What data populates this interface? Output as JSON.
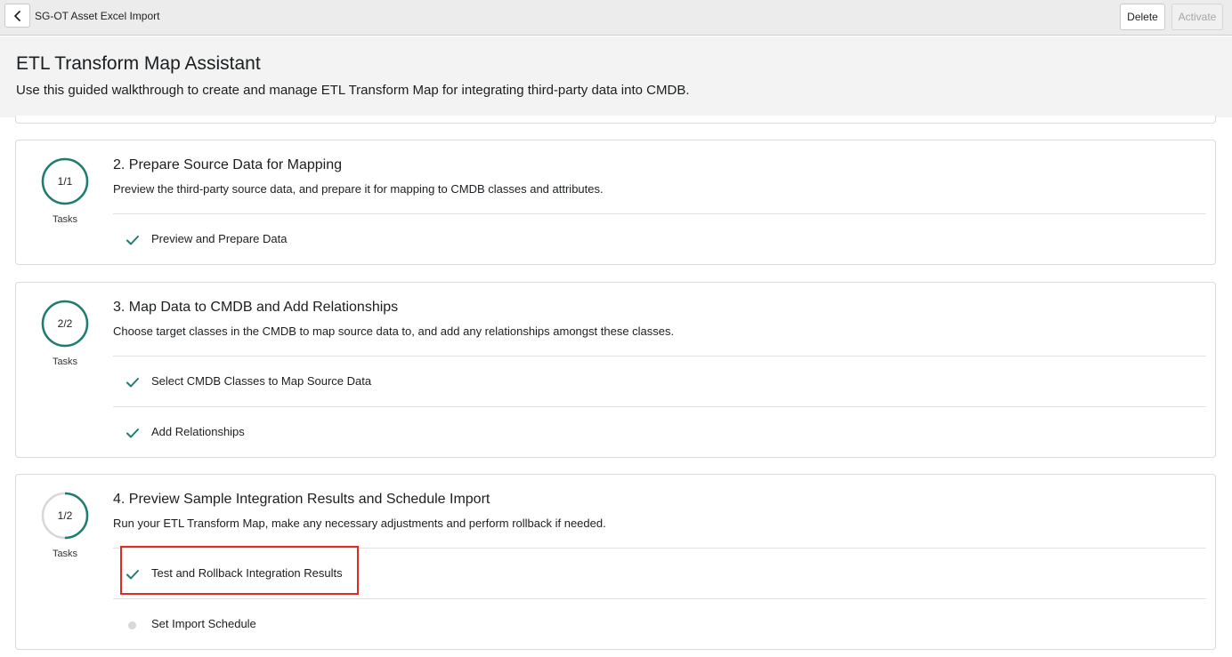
{
  "topbar": {
    "title": "SG-OT Asset Excel Import",
    "delete_label": "Delete",
    "activate_label": "Activate"
  },
  "header": {
    "title": "ETL Transform Map Assistant",
    "subtitle": "Use this guided walkthrough to create and manage ETL Transform Map for integrating third-party data into CMDB."
  },
  "colors": {
    "accent": "#1d7d6e",
    "ring_track": "#d7d7d7",
    "highlight": "#e02b20",
    "pending": "#d8d8d8"
  },
  "steps": [
    {
      "progress": "1/1",
      "completed": 1,
      "total": 1,
      "tasks_label": "Tasks",
      "title": "2. Prepare Source Data for Mapping",
      "description": "Preview the third-party source data, and prepare it for mapping to CMDB classes and attributes.",
      "tasks": [
        {
          "label": "Preview and Prepare Data",
          "status": "done",
          "icon": "check-icon"
        }
      ]
    },
    {
      "progress": "2/2",
      "completed": 2,
      "total": 2,
      "tasks_label": "Tasks",
      "title": "3. Map Data to CMDB and Add Relationships",
      "description": "Choose target classes in the CMDB to map source data to, and add any relationships amongst these classes.",
      "tasks": [
        {
          "label": "Select CMDB Classes to Map Source Data",
          "status": "done",
          "icon": "check-icon"
        },
        {
          "label": "Add Relationships",
          "status": "done",
          "icon": "check-icon"
        }
      ]
    },
    {
      "progress": "1/2",
      "completed": 1,
      "total": 2,
      "tasks_label": "Tasks",
      "title": "4. Preview Sample Integration Results and Schedule Import",
      "description": "Run your ETL Transform Map, make any necessary adjustments and perform rollback if needed.",
      "tasks": [
        {
          "label": "Test and Rollback Integration Results",
          "status": "done",
          "icon": "check-icon"
        },
        {
          "label": "Set Import Schedule",
          "status": "pending",
          "icon": "pending-dot-icon"
        }
      ]
    }
  ]
}
